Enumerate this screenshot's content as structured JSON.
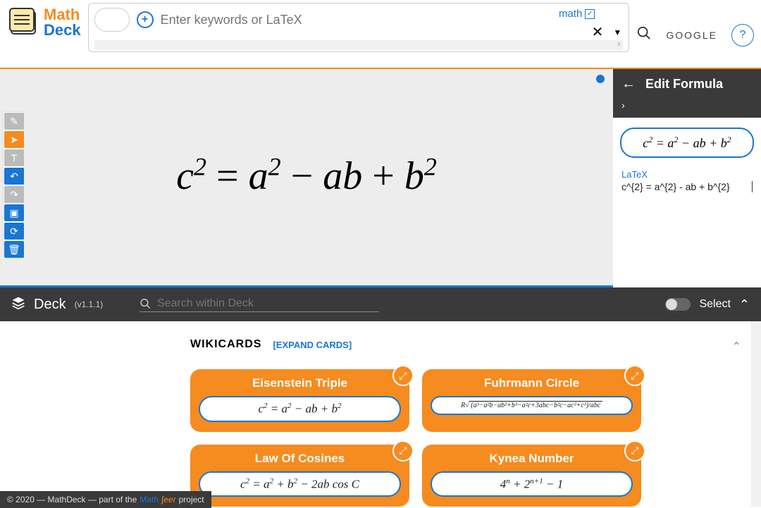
{
  "logo": {
    "line1": "Math",
    "line2": "Deck"
  },
  "search": {
    "placeholder": "Enter keywords or LaTeX",
    "math_label": "math",
    "google": "GOOGLE",
    "help": "?"
  },
  "toolbar": {
    "pen": "✎",
    "pointer": "➤",
    "text": "T",
    "undo": "↶",
    "redo": "↷",
    "image": "▣",
    "refresh": "⟳",
    "trash": "🗑"
  },
  "canvas": {
    "formula_html": "c<sup>2</sup> <span class='eq'>=</span> a<sup>2</sup> <span class='eq'>−</span> ab <span class='eq'>+</span> b<sup>2</sup>"
  },
  "edit_panel": {
    "title": "Edit Formula",
    "preview_html": "c<sup>2</sup> = a<sup>2</sup> − ab + b<sup>2</sup>",
    "latex_label": "LaTeX",
    "latex_value": "c^{2} = a^{2} - ab + b^{2}"
  },
  "deck": {
    "title": "Deck",
    "version": "(v1.1.1)",
    "search_placeholder": "Search within Deck",
    "select": "Select"
  },
  "wikicards": {
    "title": "WIKICARDS",
    "expand": "[EXPAND CARDS]",
    "cards": [
      {
        "title": "Eisenstein Triple",
        "formula_html": "c<sup>2</sup> = a<sup>2</sup> − ab + b<sup>2</sup>",
        "small": false
      },
      {
        "title": "Fuhrmann Circle",
        "formula_html": "R√<span style='text-decoration:overline'>&nbsp;(a³−a²b−ab²+b³−a²c+3abc−b²c−ac²+c³)/abc&nbsp;</span>",
        "small": true
      },
      {
        "title": "Law Of Cosines",
        "formula_html": "c<sup>2</sup> = a<sup>2</sup> + b<sup>2</sup> − 2ab cos C",
        "small": false
      },
      {
        "title": "Kynea Number",
        "formula_html": "4<sup>n</sup> + 2<sup>n+1</sup> − 1",
        "small": false
      }
    ]
  },
  "footer": {
    "copyright": "© 2020 — MathDeck — part of the",
    "brand1": "Math",
    "brand2": "∫eer",
    "tail": "project"
  }
}
